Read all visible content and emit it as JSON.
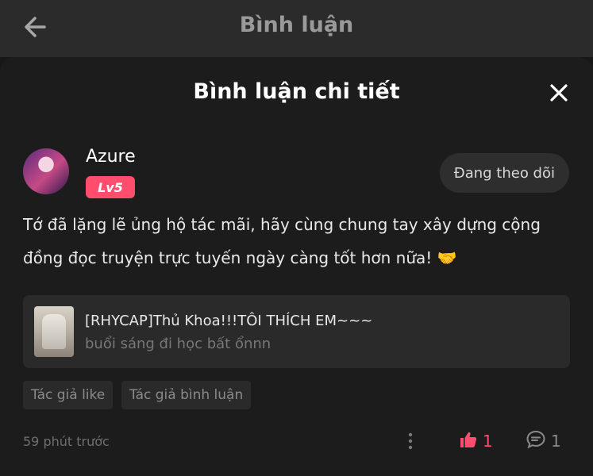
{
  "header": {
    "title": "Bình luận"
  },
  "sheet": {
    "title": "Bình luận chi tiết"
  },
  "comment": {
    "username": "Azure",
    "level": "Lv5",
    "follow_label": "Đang theo dõi",
    "text": "Tớ đã lặng lẽ ủng hộ tác mãi, hãy cùng chung tay xây dựng cộng đồng đọc truyện trực tuyến ngày càng tốt hơn nữa!",
    "emoji": "🤝",
    "reference": {
      "title": "[RHYCAP]Thủ Khoa!!!TÔI THÍCH EM~~~",
      "subtitle": "buổi sáng đi học bất ổnnn"
    },
    "tags": [
      "Tác giả like",
      "Tác giả bình luận"
    ],
    "time": "59 phút trước",
    "like_count": "1",
    "reply_count": "1"
  },
  "colors": {
    "accent": "#ff4d6d",
    "background": "#1c1c1c",
    "topbar": "#2b2b2b"
  },
  "icons": [
    "back-arrow-icon",
    "close-icon",
    "more-vertical-icon",
    "thumbs-up-icon",
    "comment-bubble-icon",
    "handshake-emoji"
  ]
}
